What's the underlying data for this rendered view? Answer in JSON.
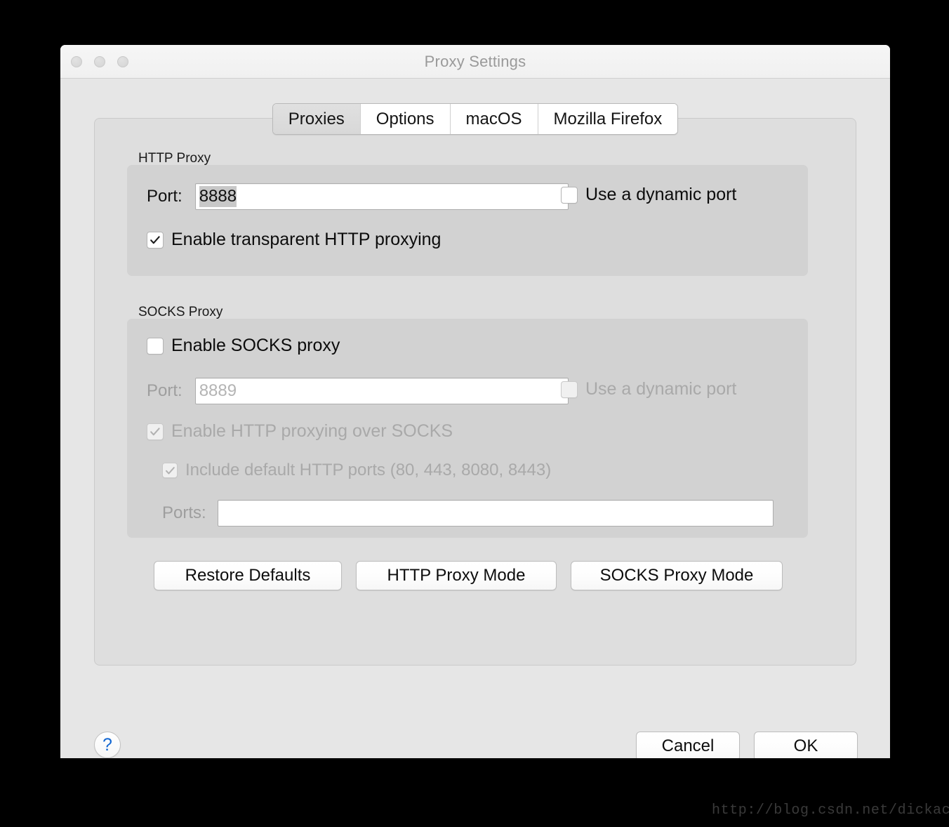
{
  "window": {
    "title": "Proxy Settings",
    "traffic_lights": [
      "close-button",
      "minimize-button",
      "zoom-button"
    ]
  },
  "tabs": [
    {
      "label": "Proxies",
      "selected": true
    },
    {
      "label": "Options",
      "selected": false
    },
    {
      "label": "macOS",
      "selected": false
    },
    {
      "label": "Mozilla Firefox",
      "selected": false
    }
  ],
  "http_proxy": {
    "group_label": "HTTP Proxy",
    "port_label": "Port:",
    "port_value": "8888",
    "port_value_selected": true,
    "dynamic_port": {
      "label": "Use a dynamic port",
      "checked": false,
      "enabled": true
    },
    "transparent": {
      "label": "Enable transparent HTTP proxying",
      "checked": true,
      "enabled": true
    }
  },
  "socks_proxy": {
    "group_label": "SOCKS Proxy",
    "enable": {
      "label": "Enable SOCKS proxy",
      "checked": false,
      "enabled": true
    },
    "port_label": "Port:",
    "port_placeholder": "8889",
    "port_value": "",
    "dynamic_port": {
      "label": "Use a dynamic port",
      "checked": false,
      "enabled": false
    },
    "http_over_socks": {
      "label": "Enable HTTP proxying over SOCKS",
      "checked": true,
      "enabled": false
    },
    "include_default_ports": {
      "label": "Include default HTTP ports (80, 443, 8080, 8443)",
      "checked": true,
      "enabled": false
    },
    "ports_label": "Ports:",
    "ports_value": ""
  },
  "mode_buttons": {
    "restore_defaults": "Restore Defaults",
    "http_proxy_mode": "HTTP Proxy Mode",
    "socks_proxy_mode": "SOCKS Proxy Mode"
  },
  "footer": {
    "help": "?",
    "cancel": "Cancel",
    "ok": "OK"
  },
  "watermark": "http://blog.csdn.net/dickaccount",
  "colors": {
    "desktop": "#000000",
    "window_bg": "#e6e6e6",
    "panel_bg": "#dedede",
    "groupbox_bg": "#d2d2d2",
    "title_text": "#9a9a9a",
    "disabled_text": "#a9a9a9",
    "help_blue": "#1267d2",
    "selection_gray": "#c8c8c8"
  }
}
